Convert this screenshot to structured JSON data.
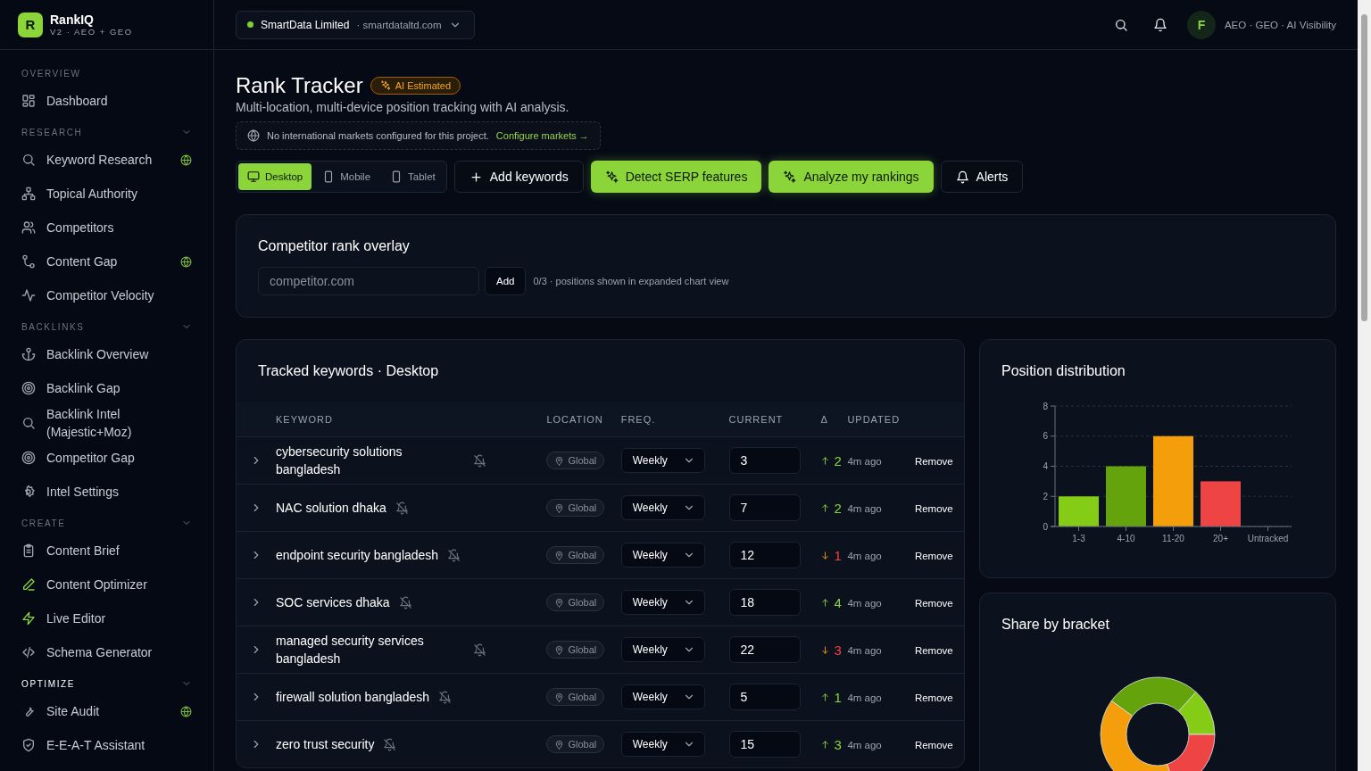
{
  "brand": {
    "logo_letter": "R",
    "name": "RankIQ",
    "subtitle": "V2 · AEO + GEO"
  },
  "sidebar": {
    "sections": [
      {
        "heading": "OVERVIEW",
        "collapsible": false,
        "active": false,
        "items": [
          {
            "label": "Dashboard",
            "globe": false,
            "accent": false
          }
        ]
      },
      {
        "heading": "RESEARCH",
        "collapsible": true,
        "active": false,
        "items": [
          {
            "label": "Keyword Research",
            "globe": true,
            "accent": false
          },
          {
            "label": "Topical Authority",
            "globe": false,
            "accent": false
          },
          {
            "label": "Competitors",
            "globe": false,
            "accent": false
          },
          {
            "label": "Content Gap",
            "globe": true,
            "accent": false
          },
          {
            "label": "Competitor Velocity",
            "globe": false,
            "accent": false
          }
        ]
      },
      {
        "heading": "BACKLINKS",
        "collapsible": true,
        "active": false,
        "items": [
          {
            "label": "Backlink Overview",
            "globe": false,
            "accent": false
          },
          {
            "label": "Backlink Gap",
            "globe": false,
            "accent": false
          },
          {
            "label": "Backlink Intel (Majestic+Moz)",
            "globe": false,
            "accent": false
          },
          {
            "label": "Competitor Gap",
            "globe": false,
            "accent": false
          },
          {
            "label": "Intel Settings",
            "globe": false,
            "accent": false
          }
        ]
      },
      {
        "heading": "CREATE",
        "collapsible": true,
        "active": false,
        "items": [
          {
            "label": "Content Brief",
            "globe": false,
            "accent": false
          },
          {
            "label": "Content Optimizer",
            "globe": false,
            "accent": true
          },
          {
            "label": "Live Editor",
            "globe": false,
            "accent": true
          },
          {
            "label": "Schema Generator",
            "globe": false,
            "accent": false
          }
        ]
      },
      {
        "heading": "OPTIMIZE",
        "collapsible": true,
        "active": true,
        "items": [
          {
            "label": "Site Audit",
            "globe": true,
            "accent": false
          },
          {
            "label": "E-E-A-T Assistant",
            "globe": false,
            "accent": false
          }
        ]
      }
    ]
  },
  "header": {
    "project": {
      "name": "SmartData Limited",
      "domain": "· smartdataltd.com"
    },
    "user": {
      "initial": "F",
      "tagline": "AEO · GEO · AI Visibility"
    }
  },
  "page": {
    "title": "Rank Tracker",
    "badge": "AI Estimated",
    "subtitle": "Multi-location, multi-device position tracking with AI analysis.",
    "notice": {
      "text": "No international markets configured for this project.",
      "link": "Configure markets →"
    }
  },
  "device_tabs": [
    {
      "label": "Desktop",
      "selected": true
    },
    {
      "label": "Mobile",
      "selected": false
    },
    {
      "label": "Tablet",
      "selected": false
    }
  ],
  "actions": [
    {
      "label": "Add keywords",
      "kind": "outline"
    },
    {
      "label": "Detect SERP features",
      "kind": "primary"
    },
    {
      "label": "Analyze my rankings",
      "kind": "primary"
    },
    {
      "label": "Alerts",
      "kind": "outline"
    }
  ],
  "overlay": {
    "title": "Competitor rank overlay",
    "placeholder": "competitor.com",
    "button": "Add",
    "count": "0/3 ·",
    "note": "positions shown in expanded chart view"
  },
  "keywords": {
    "title": "Tracked keywords · Desktop",
    "columns": [
      "KEYWORD",
      "LOCATION",
      "FREQ.",
      "CURRENT",
      "Δ",
      "UPDATED"
    ],
    "rows": [
      {
        "keyword": "cybersecurity solutions bangladesh",
        "location": "Global",
        "frequency": "Weekly",
        "current": "3",
        "kind": "up",
        "delta": "2",
        "updated": "4m ago",
        "action": "Remove"
      },
      {
        "keyword": "NAC solution dhaka",
        "location": "Global",
        "frequency": "Weekly",
        "current": "7",
        "kind": "up",
        "delta": "2",
        "updated": "4m ago",
        "action": "Remove"
      },
      {
        "keyword": "endpoint security bangladesh",
        "location": "Global",
        "frequency": "Weekly",
        "current": "12",
        "kind": "down",
        "delta": "1",
        "updated": "4m ago",
        "action": "Remove"
      },
      {
        "keyword": "SOC services dhaka",
        "location": "Global",
        "frequency": "Weekly",
        "current": "18",
        "kind": "up",
        "delta": "4",
        "updated": "4m ago",
        "action": "Remove"
      },
      {
        "keyword": "managed security services bangladesh",
        "location": "Global",
        "frequency": "Weekly",
        "current": "22",
        "kind": "down",
        "delta": "3",
        "updated": "4m ago",
        "action": "Remove"
      },
      {
        "keyword": "firewall solution bangladesh",
        "location": "Global",
        "frequency": "Weekly",
        "current": "5",
        "kind": "up",
        "delta": "1",
        "updated": "4m ago",
        "action": "Remove"
      },
      {
        "keyword": "zero trust security",
        "location": "Global",
        "frequency": "Weekly",
        "current": "15",
        "kind": "up",
        "delta": "3",
        "updated": "4m ago",
        "action": "Remove"
      }
    ]
  },
  "position_distribution": {
    "bars": [
      {
        "color": "#84cc16"
      },
      {
        "color": "#65a30d"
      },
      {
        "color": "#f59e0b"
      },
      {
        "color": "#ef4444"
      }
    ],
    "chart_data": {
      "type": "bar",
      "title": "Position distribution",
      "categories": [
        "1-3",
        "4-10",
        "11-20",
        "20+",
        "Untracked"
      ],
      "values": [
        2,
        4,
        6,
        3,
        0
      ],
      "ylim": [
        0,
        8
      ],
      "yticks": [
        0,
        2,
        4,
        6,
        8
      ],
      "grid": true
    }
  },
  "share_by_bracket": {
    "title": "Share by bracket"
  }
}
